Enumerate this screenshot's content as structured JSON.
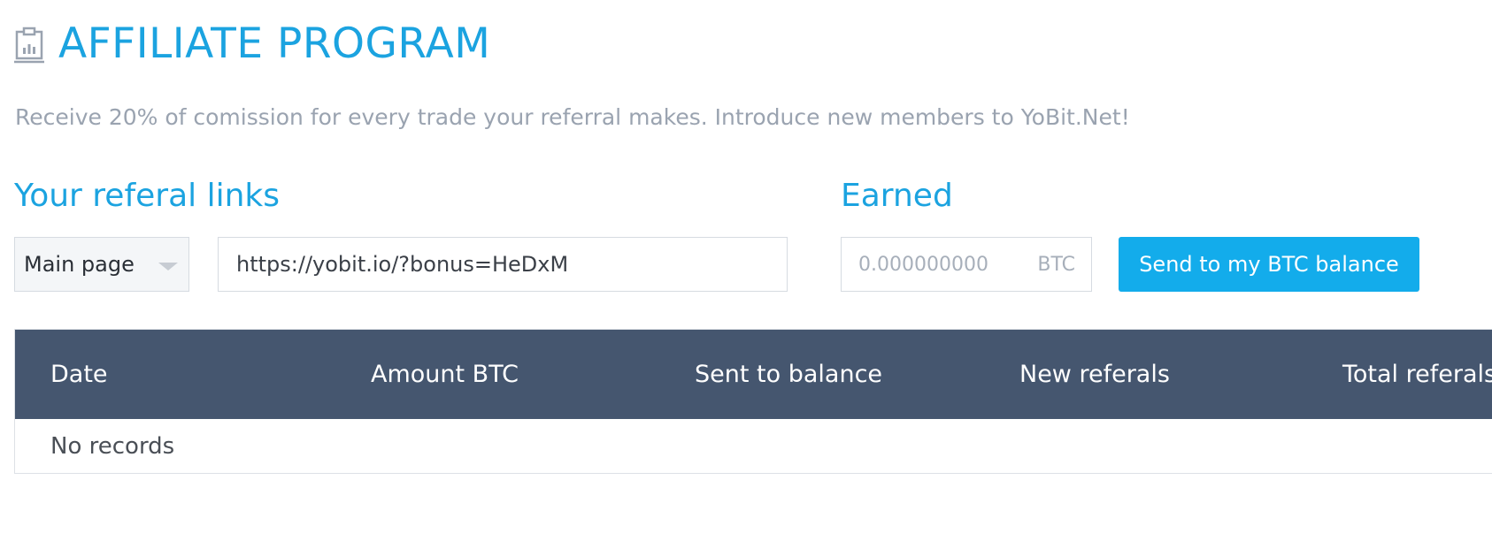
{
  "header": {
    "title": "AFFILIATE PROGRAM",
    "icon": "clipboard-chart-icon"
  },
  "intro": {
    "text": "Receive 20% of comission for every trade your referral makes. Introduce new members to YoBit.Net!"
  },
  "links_section": {
    "title": "Your referal links",
    "page_select": {
      "selected": "Main page"
    },
    "link_value": "https://yobit.io/?bonus=HeDxM"
  },
  "earned_section": {
    "title": "Earned",
    "placeholder": "0.000000000",
    "unit": "BTC",
    "send_button_label": "Send to my BTC balance"
  },
  "table": {
    "columns": [
      "Date",
      "Amount BTC",
      "Sent to balance",
      "New referals",
      "Total referals"
    ],
    "empty_text": "No records"
  },
  "colors": {
    "accent": "#1ba3e0",
    "button": "#13aceb",
    "table_header": "#45566f",
    "muted_text": "#9aa3b0"
  }
}
